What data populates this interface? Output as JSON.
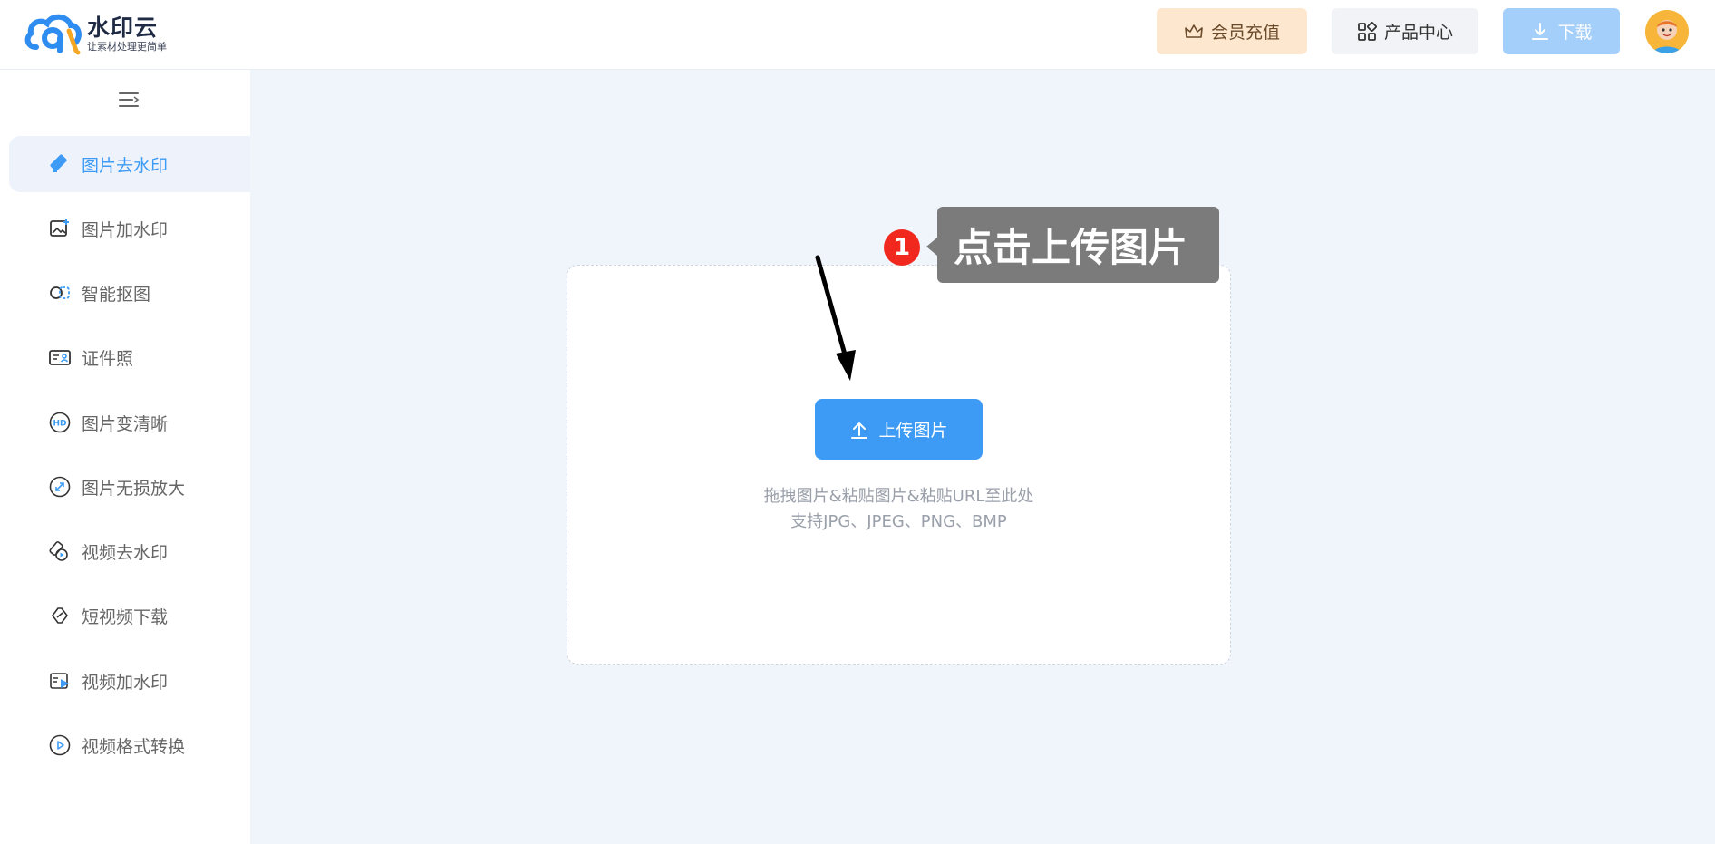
{
  "header": {
    "logo_title": "水印云",
    "logo_subtitle": "让素材处理更简单",
    "vip_button": "会员充值",
    "products_button": "产品中心",
    "download_button": "下载"
  },
  "sidebar": {
    "items": [
      {
        "label": "图片去水印",
        "icon": "eraser-icon",
        "active": true
      },
      {
        "label": "图片加水印",
        "icon": "image-add-icon",
        "active": false
      },
      {
        "label": "智能抠图",
        "icon": "cutout-icon",
        "active": false
      },
      {
        "label": "证件照",
        "icon": "id-card-icon",
        "active": false
      },
      {
        "label": "图片变清晰",
        "icon": "hd-icon",
        "active": false
      },
      {
        "label": "图片无损放大",
        "icon": "enlarge-icon",
        "active": false
      },
      {
        "label": "视频去水印",
        "icon": "video-eraser-icon",
        "active": false
      },
      {
        "label": "短视频下载",
        "icon": "link-icon",
        "active": false
      },
      {
        "label": "视频加水印",
        "icon": "video-add-icon",
        "active": false
      },
      {
        "label": "视频格式转换",
        "icon": "play-circle-icon",
        "active": false
      }
    ]
  },
  "main": {
    "upload_button": "上传图片",
    "hint_line1": "拖拽图片&粘贴图片&粘贴URL至此处",
    "hint_line2": "支持JPG、JPEG、PNG、BMP"
  },
  "annotation": {
    "step_number": "1",
    "callout_text": "点击上传图片"
  },
  "colors": {
    "accent": "#3d9bf6",
    "vip_bg": "#fde8cf",
    "download_bg": "#a4cffb",
    "page_bg": "#f0f4fb",
    "badge_red": "#f0281e",
    "callout_bg": "#7b7b7b"
  }
}
